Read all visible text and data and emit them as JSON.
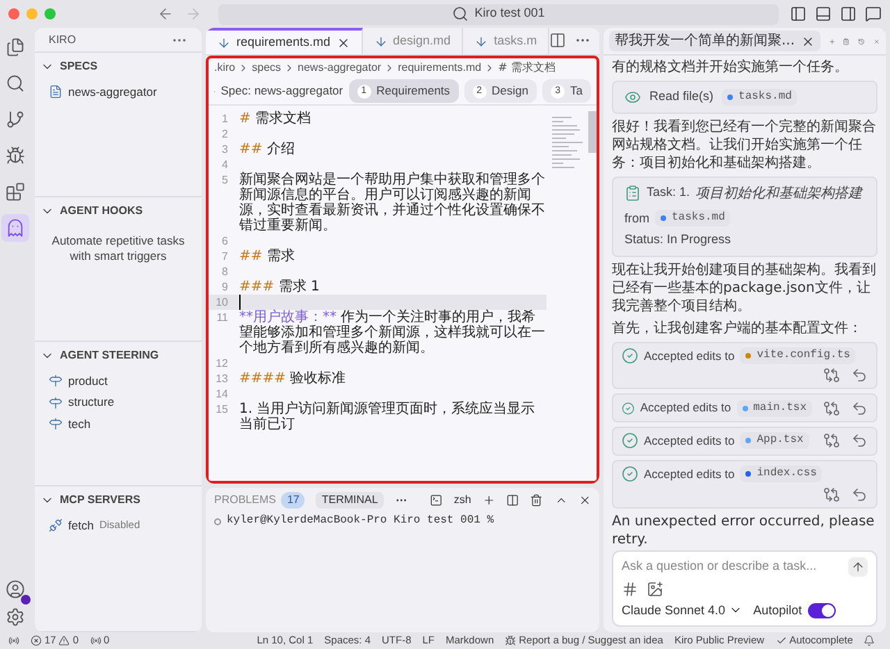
{
  "window": {
    "title": "Kiro test 001"
  },
  "activity_bar": [
    {
      "kind": "files",
      "selected": false
    },
    {
      "kind": "search",
      "selected": false
    },
    {
      "kind": "source",
      "selected": false
    },
    {
      "kind": "debug",
      "selected": false
    },
    {
      "kind": "extensions",
      "selected": false
    },
    {
      "kind": "kiro",
      "selected": true
    }
  ],
  "sidebar": {
    "title": "KIRO",
    "sections": [
      {
        "title": "SPECS",
        "expanded": true,
        "items": [
          {
            "kind": "spec",
            "label": "news-aggregator"
          }
        ]
      },
      {
        "title": "AGENT HOOKS",
        "expanded": true,
        "message": "Automate repetitive tasks with smart triggers"
      },
      {
        "title": "AGENT STEERING",
        "expanded": true,
        "items": [
          {
            "kind": "steering",
            "label": "product"
          },
          {
            "kind": "steering",
            "label": "structure"
          },
          {
            "kind": "steering",
            "label": "tech"
          }
        ]
      },
      {
        "title": "MCP SERVERS",
        "expanded": true,
        "items": [
          {
            "kind": "server",
            "label": "fetch",
            "status": "Disabled"
          }
        ]
      }
    ]
  },
  "editor": {
    "tabs": [
      {
        "label": "requirements.md",
        "selected": true
      },
      {
        "label": "design.md",
        "selected": false
      },
      {
        "label": "tasks.m",
        "selected": false
      }
    ],
    "breadcrumb": [
      ".kiro",
      "specs",
      "news-aggregator",
      "requirements.md",
      "# 需求文档"
    ],
    "spec_label": "Spec: news-aggregator",
    "steps": [
      {
        "number": "1",
        "label": "Requirements",
        "selected": true
      },
      {
        "number": "2",
        "label": "Design",
        "selected": false
      },
      {
        "number": "3",
        "label": "Ta",
        "selected": false
      }
    ],
    "lines": [
      {
        "number": "1",
        "marker": "#",
        "text": "需求文档"
      },
      {
        "number": "2"
      },
      {
        "number": "3",
        "marker": "##",
        "text": "介绍"
      },
      {
        "number": "4"
      },
      {
        "number": "5",
        "text": "新闻聚合网站是一个帮助用户集中获取和管理多个新闻源信息的平台。用户可以订阅感兴趣的新闻源，实时查看最新资讯，并通过个性化设置确保不错过重要新闻。"
      },
      {
        "number": "6"
      },
      {
        "number": "7",
        "marker": "##",
        "text": "需求"
      },
      {
        "number": "8"
      },
      {
        "number": "9",
        "marker": "###",
        "text": "需求 1"
      },
      {
        "number": "10",
        "current": true
      },
      {
        "number": "11",
        "emphasis": "**用户故事：**",
        "text": "作为一个关注时事的用户，我希望能够添加和管理多个新闻源，这样我就可以在一个地方看到所有感兴趣的新闻。"
      },
      {
        "number": "12"
      },
      {
        "number": "13",
        "marker": "####",
        "text": "验收标准"
      },
      {
        "number": "14"
      },
      {
        "number": "15",
        "text": "1. 当用户访问新闻源管理页面时，系统应当显示当前已订"
      }
    ]
  },
  "panel": {
    "tabs": [
      {
        "label": "PROBLEMS",
        "badge": "17",
        "selected": false
      },
      {
        "label": "TERMINAL",
        "selected": true
      }
    ],
    "shell": "zsh",
    "lines": [
      "kyler@KylerdeMacBook-Pro Kiro test 001 %"
    ]
  },
  "chat": {
    "tab_title": "帮我开发一个简单的新闻聚...",
    "messages": [
      {
        "kind": "text",
        "text": "有的规格文档并开始实施第一个任务。"
      },
      {
        "kind": "read",
        "label": "Read file(s)",
        "file": "tasks.md",
        "color": "#3b82f6"
      },
      {
        "kind": "text",
        "text": "很好！我看到您已经有一个完整的新闻聚合网站规格文档。让我们开始实施第一个任务：项目初始化和基础架构搭建。"
      },
      {
        "kind": "task",
        "prefix": "Task: 1.",
        "title": "项目初始化和基础架构搭建",
        "suffix": "from",
        "file": "tasks.md",
        "color": "#3b82f6",
        "status": "Status: In Progress"
      },
      {
        "kind": "text",
        "text": "现在让我开始创建项目的基础架构。我看到已经有一些基本的package.json文件，让我完善整个项目结构。"
      },
      {
        "kind": "text",
        "text": "首先，让我创建客户端的基本配置文件："
      },
      {
        "kind": "edit",
        "label": "Accepted edits to",
        "file": "vite.config.ts",
        "color": "#ca8a04",
        "tall": true
      },
      {
        "kind": "edit",
        "label": "Accepted edits to",
        "file": "main.tsx",
        "color": "#60a5fa",
        "tall": false
      },
      {
        "kind": "edit",
        "label": "Accepted edits to",
        "file": "App.tsx",
        "color": "#60a5fa",
        "tall": false
      },
      {
        "kind": "edit",
        "label": "Accepted edits to",
        "file": "index.css",
        "color": "#2563eb",
        "tall": true
      },
      {
        "kind": "text",
        "text": "An unexpected error occurred, please retry."
      }
    ],
    "input": {
      "placeholder": "Ask a question or describe a task...",
      "model": "Claude Sonnet 4.0",
      "autopilot_label": "Autopilot",
      "autopilot": true
    }
  },
  "status_bar": {
    "errors": "17",
    "warnings": "0",
    "ports": "0",
    "items": [
      "Ln 10, Col 1",
      "Spaces: 4",
      "UTF-8",
      "LF",
      "Markdown"
    ],
    "report": "Report a bug / Suggest an idea",
    "preview": "Kiro Public Preview",
    "autocomplete": "Autocomplete"
  }
}
